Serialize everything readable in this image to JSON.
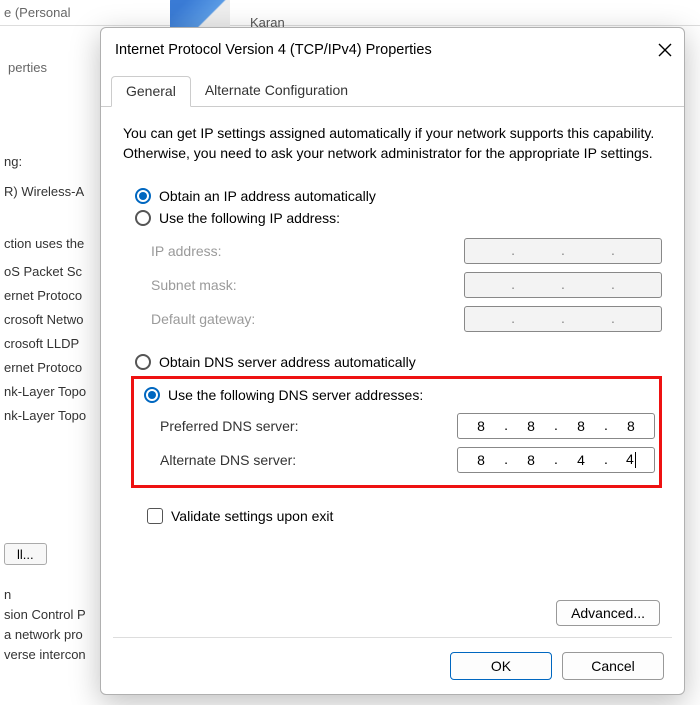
{
  "background": {
    "title_fragment": "e (Personal",
    "properties_label": "perties",
    "connecting_label": "ng:",
    "adapter_label": "R) Wireless-A",
    "list_heading": "ction uses the",
    "items": [
      "oS Packet Sc",
      "ernet Protoco",
      "crosoft Netwo",
      "crosoft LLDP",
      "ernet Protoco",
      "nk-Layer Topo",
      "nk-Layer Topo"
    ],
    "install_button": "ll...",
    "desc_lines": [
      "n",
      "sion Control P",
      "a network pro",
      "verse intercon"
    ],
    "user_name": "Karan"
  },
  "dialog": {
    "title": "Internet Protocol Version 4 (TCP/IPv4) Properties",
    "tabs": {
      "general": "General",
      "alt": "Alternate Configuration"
    },
    "description": "You can get IP settings assigned automatically if your network supports this capability. Otherwise, you need to ask your network administrator for the appropriate IP settings.",
    "ip": {
      "auto_label": "Obtain an IP address automatically",
      "manual_label": "Use the following IP address:",
      "fields": {
        "ip_address": "IP address:",
        "subnet": "Subnet mask:",
        "gateway": "Default gateway:"
      }
    },
    "dns": {
      "auto_label": "Obtain DNS server address automatically",
      "manual_label": "Use the following DNS server addresses:",
      "fields": {
        "preferred": "Preferred DNS server:",
        "alternate": "Alternate DNS server:"
      },
      "preferred_value": [
        "8",
        "8",
        "8",
        "8"
      ],
      "alternate_value": [
        "8",
        "8",
        "4",
        "4"
      ]
    },
    "validate_label": "Validate settings upon exit",
    "advanced_label": "Advanced...",
    "ok_label": "OK",
    "cancel_label": "Cancel"
  }
}
